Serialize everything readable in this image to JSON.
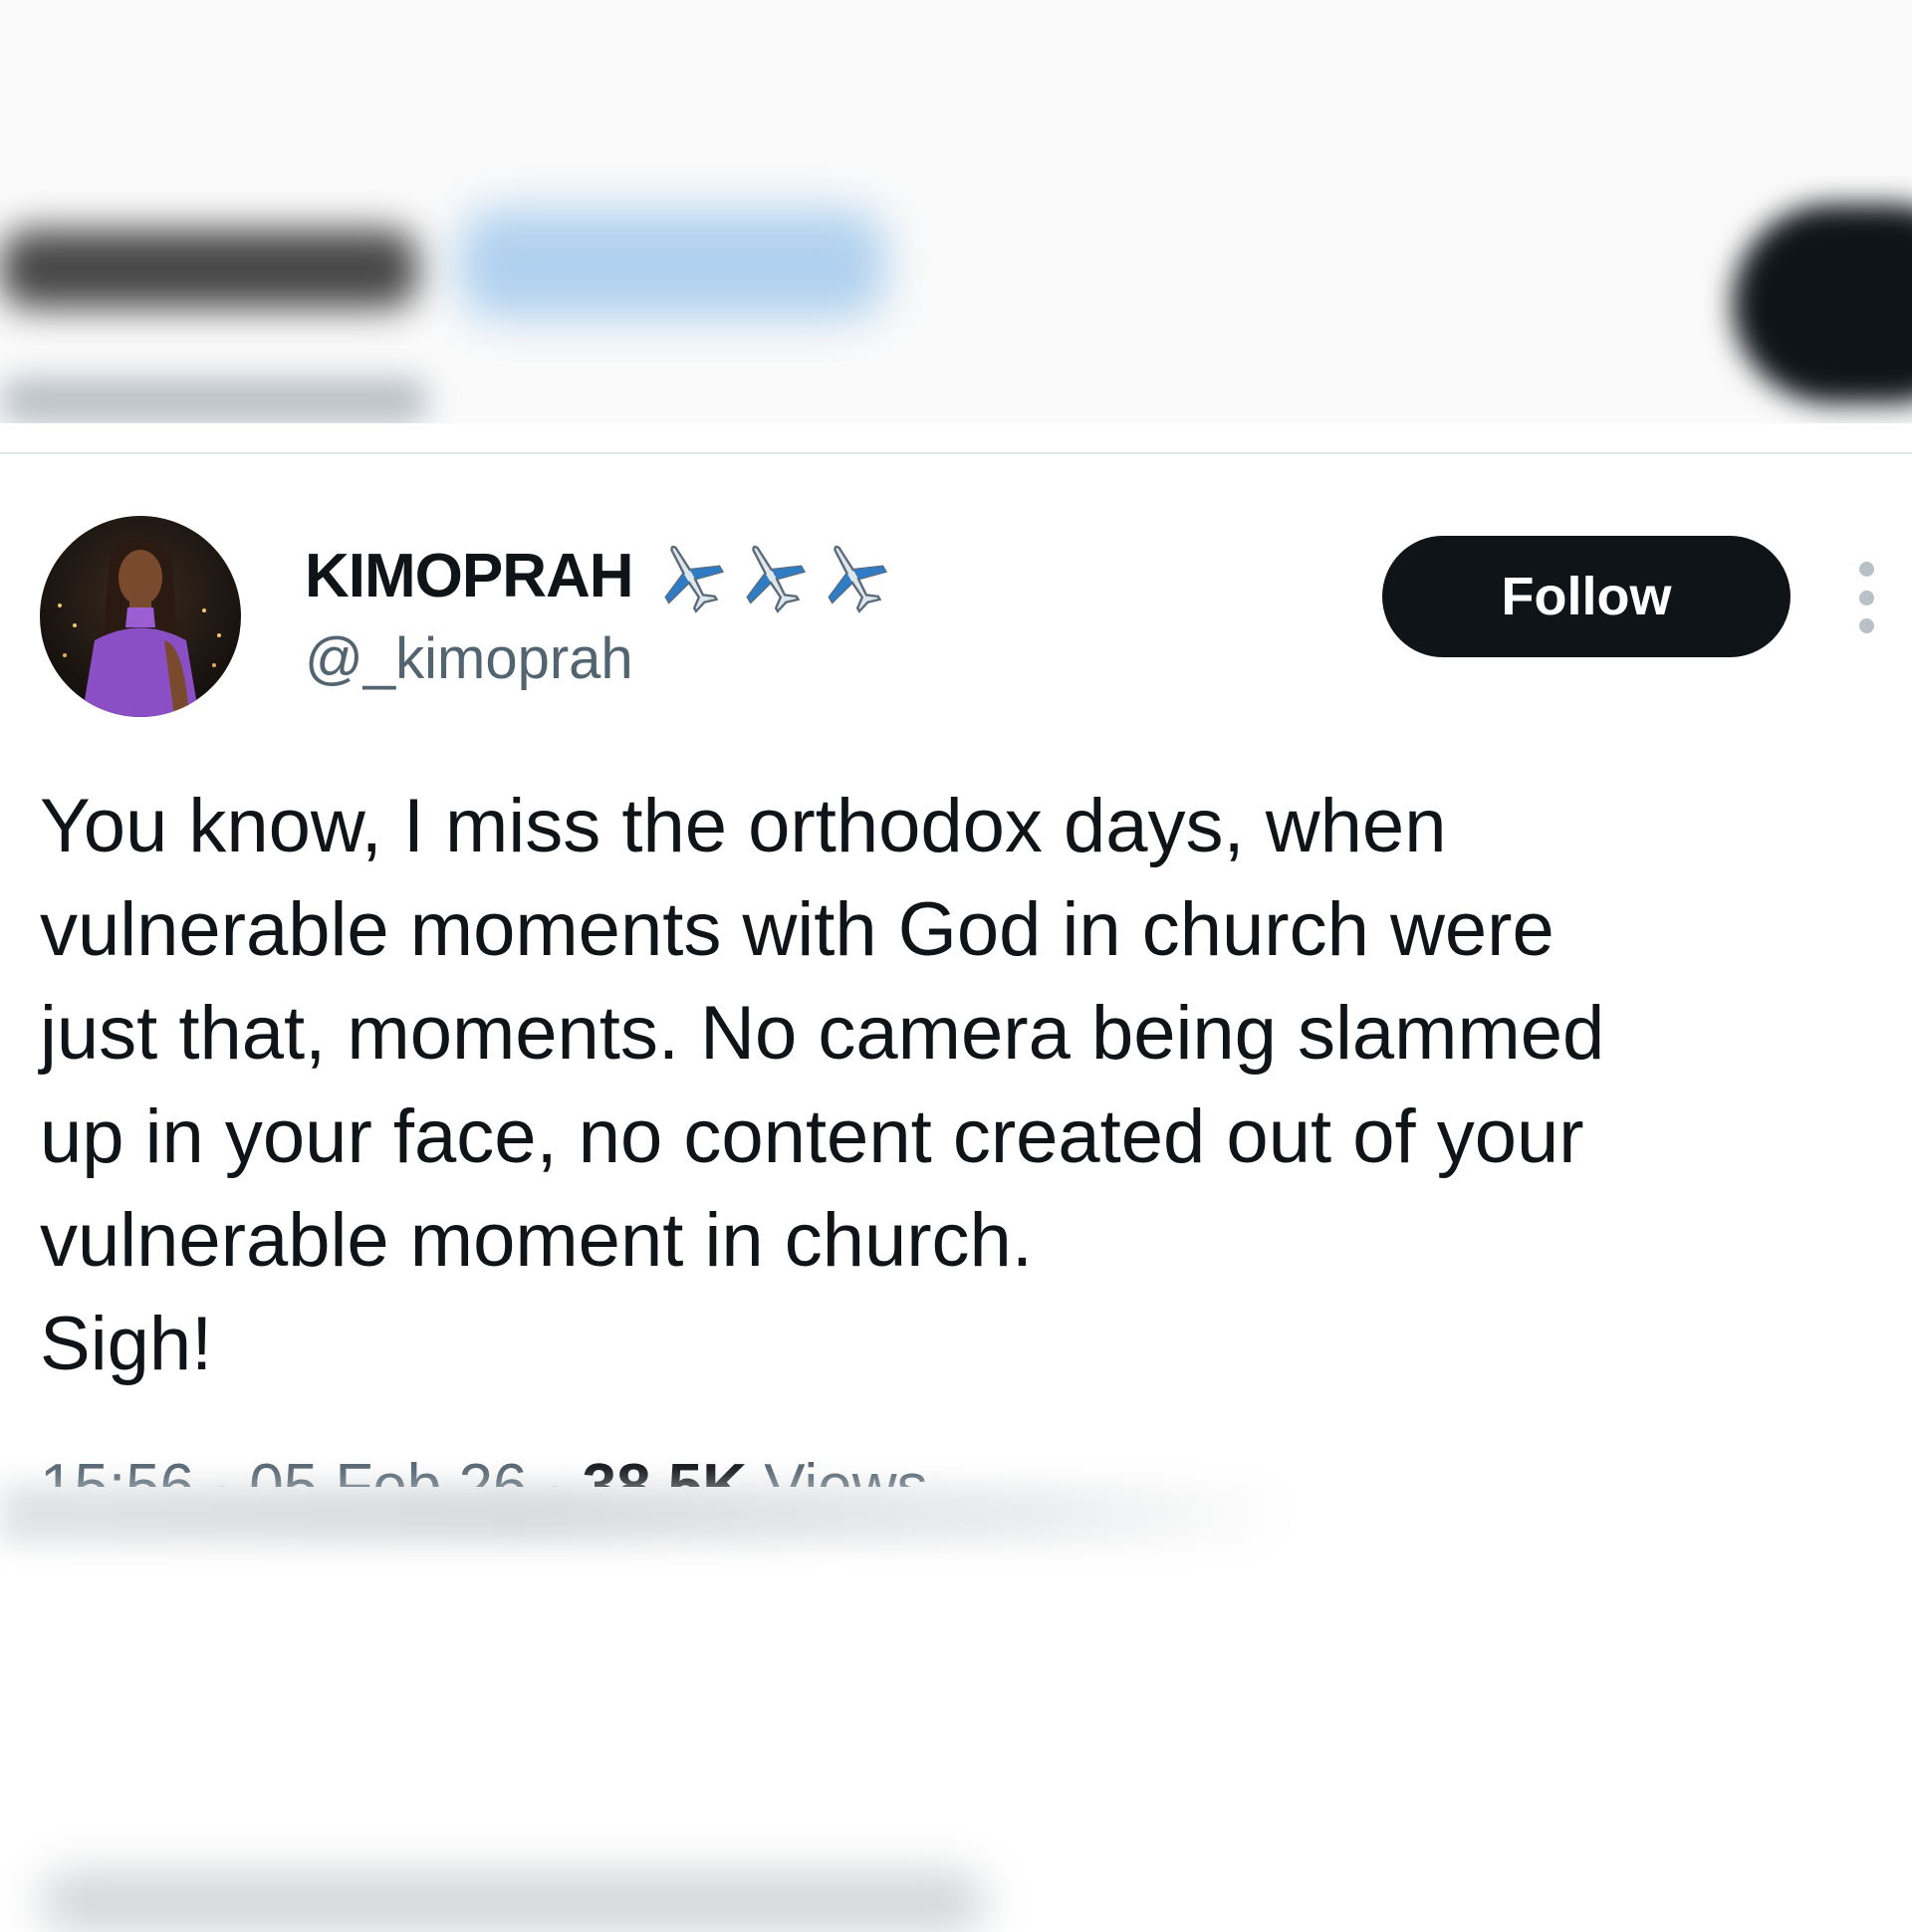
{
  "tweet": {
    "display_name": "KIMOPRAH",
    "name_emoji": [
      "airplane-emoji",
      "airplane-emoji",
      "airplane-emoji"
    ],
    "handle": "@_kimoprah",
    "follow_label": "Follow",
    "text_lines": [
      "You know, I miss the orthodox days, when",
      "vulnerable moments with God in church were",
      "just that, moments. No camera being slammed",
      "up in your face, no content created out of your",
      "vulnerable moment in church.",
      "Sigh!"
    ],
    "time": "15:56",
    "date": "05 Feb 26",
    "views_count": "38.5K",
    "views_label": "Views"
  },
  "colors": {
    "text_primary": "#0f1419",
    "text_secondary": "#536471",
    "button_bg": "#0f1419",
    "button_text": "#ffffff",
    "divider": "#e1e6ea",
    "avatar_dress": "#8a4fc4"
  }
}
